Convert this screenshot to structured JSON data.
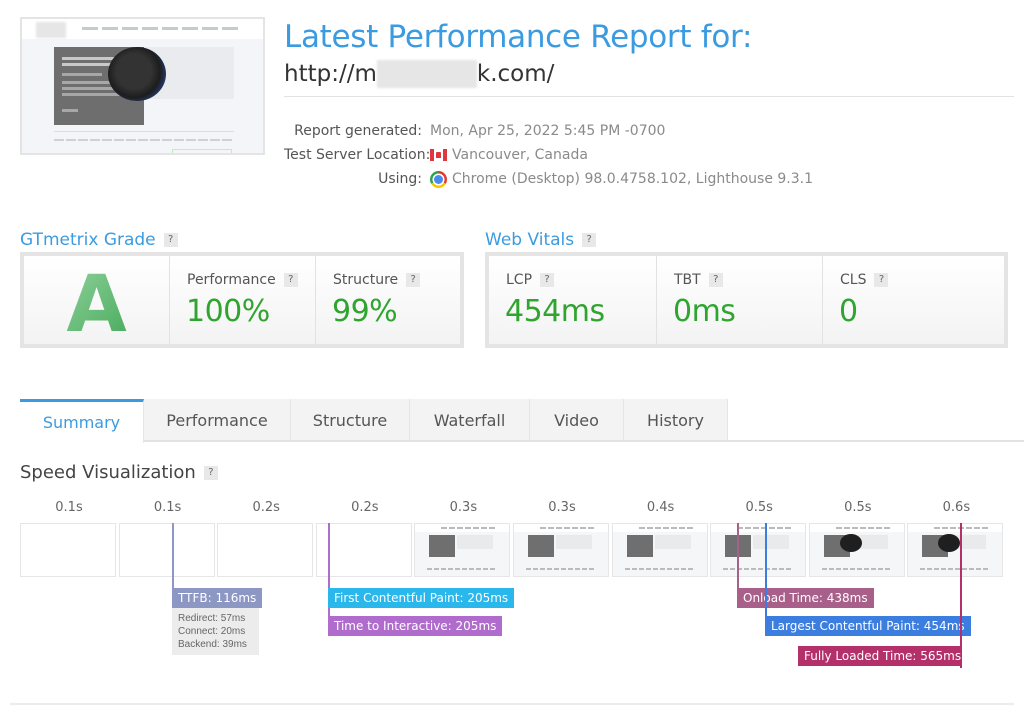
{
  "header": {
    "title": "Latest Performance Report for:",
    "url_prefix": "http://m",
    "url_suffix": "k.com/",
    "meta": [
      {
        "key": "Report generated:",
        "value": "Mon, Apr 25, 2022 5:45 PM -0700",
        "icon": null
      },
      {
        "key": "Test Server Location:",
        "value": "Vancouver, Canada",
        "icon": "canada-flag-icon"
      },
      {
        "key": "Using:",
        "value": "Chrome (Desktop) 98.0.4758.102, Lighthouse 9.3.1",
        "icon": "chrome-icon"
      }
    ]
  },
  "grade": {
    "heading": "GTmetrix Grade",
    "help": "?",
    "letter": "A",
    "metrics": [
      {
        "label": "Performance",
        "value": "100%"
      },
      {
        "label": "Structure",
        "value": "99%"
      }
    ]
  },
  "vitals": {
    "heading": "Web Vitals",
    "help": "?",
    "metrics": [
      {
        "label": "LCP",
        "value": "454ms"
      },
      {
        "label": "TBT",
        "value": "0ms"
      },
      {
        "label": "CLS",
        "value": "0"
      }
    ]
  },
  "tabs": [
    {
      "label": "Summary",
      "active": true
    },
    {
      "label": "Performance",
      "active": false
    },
    {
      "label": "Structure",
      "active": false
    },
    {
      "label": "Waterfall",
      "active": false
    },
    {
      "label": "Video",
      "active": false
    },
    {
      "label": "History",
      "active": false
    }
  ],
  "speed": {
    "heading": "Speed Visualization",
    "help": "?",
    "frames": [
      {
        "time": "0.1s",
        "state": "blank"
      },
      {
        "time": "0.1s",
        "state": "blank"
      },
      {
        "time": "0.2s",
        "state": "blank"
      },
      {
        "time": "0.2s",
        "state": "blank"
      },
      {
        "time": "0.3s",
        "state": "content"
      },
      {
        "time": "0.3s",
        "state": "content"
      },
      {
        "time": "0.4s",
        "state": "content"
      },
      {
        "time": "0.5s",
        "state": "content"
      },
      {
        "time": "0.5s",
        "state": "image"
      },
      {
        "time": "0.6s",
        "state": "image"
      }
    ],
    "markers": {
      "ttfb": {
        "label": "TTFB: 116ms",
        "color": "#8c97c4",
        "details": [
          "Redirect: 57ms",
          "Connect: 20ms",
          "Backend: 39ms"
        ]
      },
      "fcp": {
        "label": "First Contentful Paint: 205ms",
        "color": "#2ab8ec"
      },
      "tti": {
        "label": "Time to Interactive: 205ms",
        "color": "#b06ccc"
      },
      "onload": {
        "label": "Onload Time: 438ms",
        "color": "#a8608a"
      },
      "lcp": {
        "label": "Largest Contentful Paint: 454ms",
        "color": "#3c7de0"
      },
      "fully": {
        "label": "Fully Loaded Time: 565ms",
        "color": "#b3306a"
      }
    }
  }
}
